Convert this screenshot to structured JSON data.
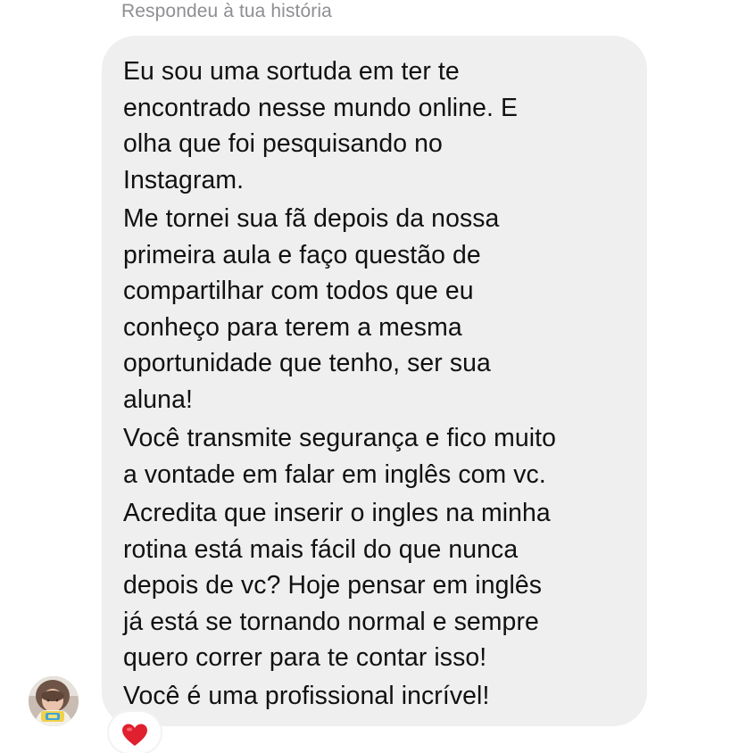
{
  "header": {
    "reply_label": "Respondeu à tua história"
  },
  "message": {
    "lines": [
      "Eu sou uma sortuda em ter te",
      "encontrado nesse mundo online. E",
      "olha que foi pesquisando no",
      "Instagram.",
      "Me tornei sua fã depois da nossa",
      "primeira aula e faço questão de",
      "compartilhar com todos que eu",
      "conheço para terem a mesma",
      "oportunidade que tenho, ser sua",
      "aluna!",
      "Você transmite segurança e fico muito",
      "a vontade em falar em inglês com vc.",
      "Acredita que inserir o ingles na minha",
      "rotina está mais fácil do que nunca",
      "depois de vc? Hoje pensar em inglês",
      "já está se tornando normal e sempre",
      "quero correr para te contar isso!",
      "Você é uma profissional incrível!"
    ]
  },
  "sender": {
    "avatar_icon": "user-avatar"
  },
  "reaction": {
    "icon": "red-heart-icon",
    "color": "#e0202e"
  },
  "colors": {
    "bubble": "#efefef",
    "text": "#111111",
    "secondary_text": "#8e8e93"
  }
}
